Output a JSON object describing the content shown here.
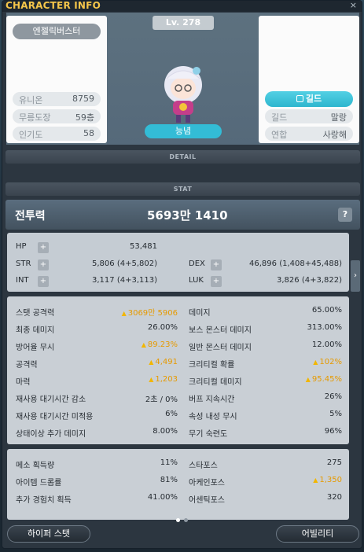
{
  "window": {
    "title": "CHARACTER INFO",
    "close": "×"
  },
  "profile": {
    "name": "엔젤릭버스터",
    "level": "Lv. 278",
    "job": "능념",
    "left_rows": [
      {
        "key": "유니온",
        "value": "8759"
      },
      {
        "key": "무릉도장",
        "value": "59층"
      },
      {
        "key": "인기도",
        "value": "58"
      }
    ],
    "guild_button": "길드",
    "right_rows": [
      {
        "key": "길드",
        "value": "말랑"
      },
      {
        "key": "연합",
        "value": "사랑해"
      }
    ]
  },
  "sections": {
    "detail": "DETAIL",
    "stat": "STAT"
  },
  "power": {
    "label": "전투력",
    "value": "5693만 1410",
    "help": "?"
  },
  "base_stats": {
    "hp": {
      "key": "HP",
      "value": "53,481"
    },
    "str": {
      "key": "STR",
      "value": "5,806 (4+5,802)"
    },
    "int": {
      "key": "INT",
      "value": "3,117 (4+3,113)"
    },
    "dex": {
      "key": "DEX",
      "value": "46,896 (1,408+45,488)"
    },
    "luk": {
      "key": "LUK",
      "value": "3,826 (4+3,822)"
    },
    "plus": "+"
  },
  "detail_left": [
    {
      "key": "스탯 공격력",
      "value": "3069만 5906",
      "up": true
    },
    {
      "key": "최종 데미지",
      "value": "26.00%",
      "up": false
    },
    {
      "key": "방어율 무시",
      "value": "89.23%",
      "up": true
    },
    {
      "key": "공격력",
      "value": "4,491",
      "up": true
    },
    {
      "key": "마력",
      "value": "1,203",
      "up": true
    },
    {
      "key": "재사용 대기시간 감소",
      "value": "2초 / 0%",
      "up": false
    },
    {
      "key": "재사용 대기시간 미적용",
      "value": "6%",
      "up": false
    },
    {
      "key": "상태이상 추가 데미지",
      "value": "8.00%",
      "up": false
    }
  ],
  "detail_right": [
    {
      "key": "데미지",
      "value": "65.00%",
      "up": false
    },
    {
      "key": "보스 몬스터 데미지",
      "value": "313.00%",
      "up": false
    },
    {
      "key": "일반 몬스터 데미지",
      "value": "12.00%",
      "up": false
    },
    {
      "key": "크리티컬 확률",
      "value": "102%",
      "up": true
    },
    {
      "key": "크리티컬 데미지",
      "value": "95.45%",
      "up": true
    },
    {
      "key": "버프 지속시간",
      "value": "26%",
      "up": false
    },
    {
      "key": "속성 내성 무시",
      "value": "5%",
      "up": false
    },
    {
      "key": "무기 숙련도",
      "value": "96%",
      "up": false
    }
  ],
  "misc_left": [
    {
      "key": "메소 획득량",
      "value": "11%",
      "up": false
    },
    {
      "key": "아이템 드롭률",
      "value": "81%",
      "up": false
    },
    {
      "key": "추가 경험치 획득",
      "value": "41.00%",
      "up": false
    }
  ],
  "misc_right": [
    {
      "key": "스타포스",
      "value": "275",
      "up": false
    },
    {
      "key": "아케인포스",
      "value": "1,350",
      "up": true
    },
    {
      "key": "어센틱포스",
      "value": "320",
      "up": false
    }
  ],
  "up_arrow": "▲",
  "side_arrow": "›",
  "buttons": {
    "hyper": "하이퍼 스탯",
    "ability": "어빌리티"
  },
  "colors": {
    "title": "#f5c64a",
    "accent": "#33bcd6",
    "up": "#f2b600"
  }
}
